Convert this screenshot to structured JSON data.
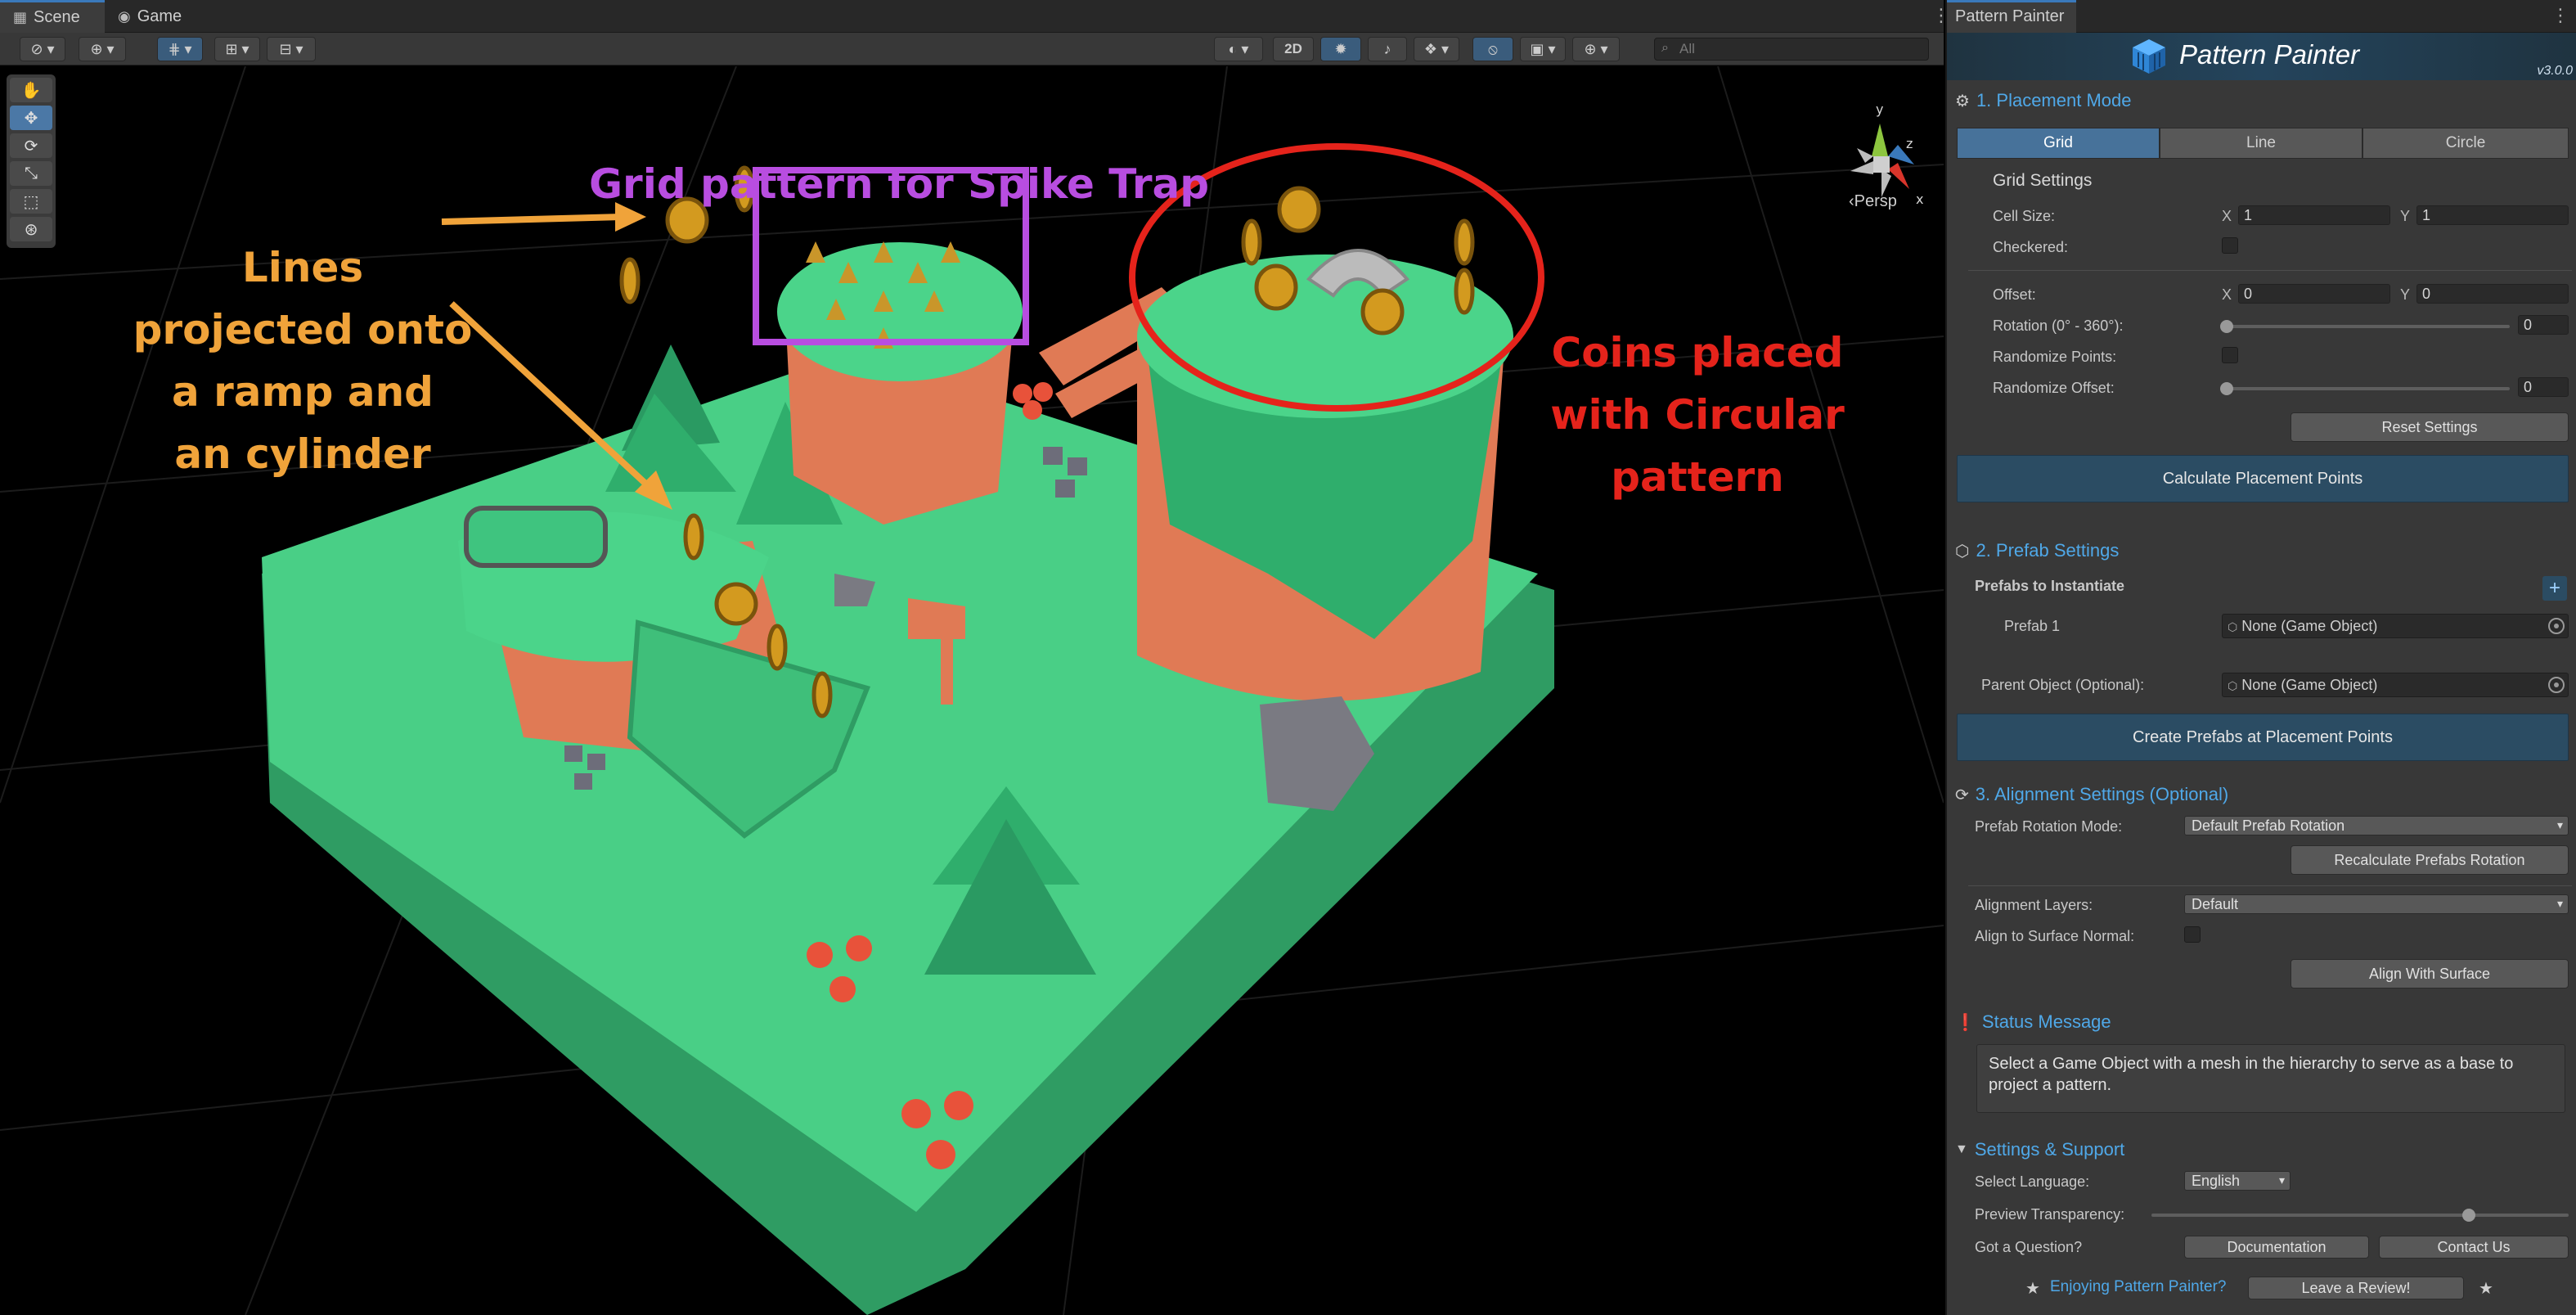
{
  "scene_tabs": {
    "scene": "Scene",
    "game": "Game"
  },
  "scene_toolbar": {
    "two_d_label": "2D",
    "search_placeholder": "All"
  },
  "viewport": {
    "persp_label": "Persp",
    "gizmo_axes": [
      "x",
      "y",
      "z"
    ],
    "annotations": {
      "grid": "Grid pattern for Spike Trap",
      "lines": [
        "Lines",
        "projected onto",
        "a ramp and",
        "an cylinder"
      ],
      "coins": [
        "Coins placed",
        "with Circular",
        "pattern"
      ]
    },
    "annotation_colors": {
      "grid": "#b84de0",
      "lines": "#f0a33a",
      "coins": "#e5231b"
    }
  },
  "panel": {
    "tab_title": "Pattern Painter",
    "title": "Pattern Painter",
    "version": "v3.0.0",
    "placement": {
      "header": "1. Placement Mode",
      "modes": [
        "Grid",
        "Line",
        "Circle"
      ],
      "active_mode": "Grid",
      "grid_settings_title": "Grid Settings",
      "cell_size_label": "Cell Size:",
      "cell_size_x": "1",
      "cell_size_y": "1",
      "checkered_label": "Checkered:",
      "offset_label": "Offset:",
      "offset_x": "0",
      "offset_y": "0",
      "rotation_label": "Rotation (0° - 360°):",
      "rotation_value": "0",
      "randomize_points_label": "Randomize Points:",
      "randomize_offset_label": "Randomize Offset:",
      "randomize_offset_value": "0",
      "reset_button": "Reset Settings",
      "calculate_button": "Calculate Placement Points"
    },
    "prefab": {
      "header": "2. Prefab Settings",
      "to_instantiate_label": "Prefabs to Instantiate",
      "prefab1_label": "Prefab 1",
      "prefab1_value": "None (Game Object)",
      "parent_label": "Parent Object (Optional):",
      "parent_value": "None (Game Object)",
      "create_button": "Create Prefabs at Placement Points"
    },
    "alignment": {
      "header": "3. Alignment Settings (Optional)",
      "rotation_mode_label": "Prefab Rotation Mode:",
      "rotation_mode_value": "Default Prefab Rotation",
      "recalc_button": "Recalculate Prefabs Rotation",
      "layers_label": "Alignment Layers:",
      "layers_value": "Default",
      "surface_normal_label": "Align to Surface Normal:",
      "align_button": "Align With Surface"
    },
    "status": {
      "header": "Status Message",
      "message": "Select a Game Object with a mesh in the hierarchy to serve as a base to project a pattern."
    },
    "support": {
      "header": "Settings & Support",
      "language_label": "Select Language:",
      "language_value": "English",
      "transparency_label": "Preview Transparency:",
      "transparency_value": 0.76,
      "question_label": "Got a Question?",
      "documentation_button": "Documentation",
      "contact_button": "Contact Us",
      "enjoying_text": "Enjoying Pattern Painter?",
      "review_button": "Leave a Review!"
    },
    "accent_color": "#4fa8e8",
    "primary_button_color": "#2b4c63"
  }
}
